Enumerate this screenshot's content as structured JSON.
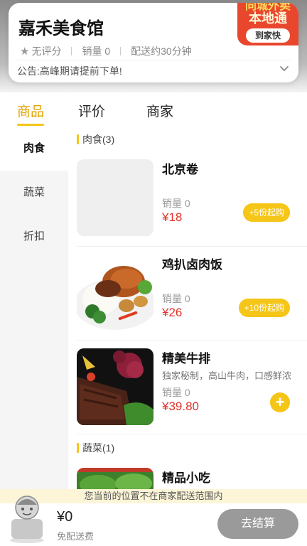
{
  "shop": {
    "name": "嘉禾美食馆",
    "rating": "无评分",
    "sales": "销量 0",
    "delivery": "配送约30分钟",
    "notice": "公告:高峰期请提前下单!"
  },
  "badge": {
    "top": "同城外卖",
    "main": "本地通",
    "sub": "到家快"
  },
  "tabs": [
    {
      "label": "商品",
      "active": true
    },
    {
      "label": "评价",
      "active": false
    },
    {
      "label": "商家",
      "active": false
    }
  ],
  "categories": [
    {
      "label": "肉食",
      "active": true
    },
    {
      "label": "蔬菜",
      "active": false
    },
    {
      "label": "折扣",
      "active": false
    }
  ],
  "sections": [
    {
      "title": "肉食(3)"
    },
    {
      "title": "蔬菜(1)"
    }
  ],
  "items": [
    {
      "name": "北京卷",
      "desc": "",
      "sales": "销量 0",
      "price": "¥18",
      "action": "+5份起购"
    },
    {
      "name": "鸡扒卤肉饭",
      "desc": "",
      "sales": "销量 0",
      "price": "¥26",
      "action": "+10份起购"
    },
    {
      "name": "精美牛排",
      "desc": "独家秘制，高山牛肉，口感鲜浓",
      "sales": "销量 0",
      "price": "¥39.80",
      "action": "+"
    },
    {
      "name": "精品小吃",
      "desc": "",
      "sales": "",
      "price": "",
      "action": ""
    }
  ],
  "range_tip": "您当前的位置不在商家配送范围内",
  "cart": {
    "total": "¥0",
    "delivery_fee": "免配送费",
    "checkout": "去结算"
  },
  "colors": {
    "accent": "#f5c518",
    "price": "#e0332a",
    "badge": "#e8472d",
    "checkout_disabled": "#9a9a9a"
  }
}
